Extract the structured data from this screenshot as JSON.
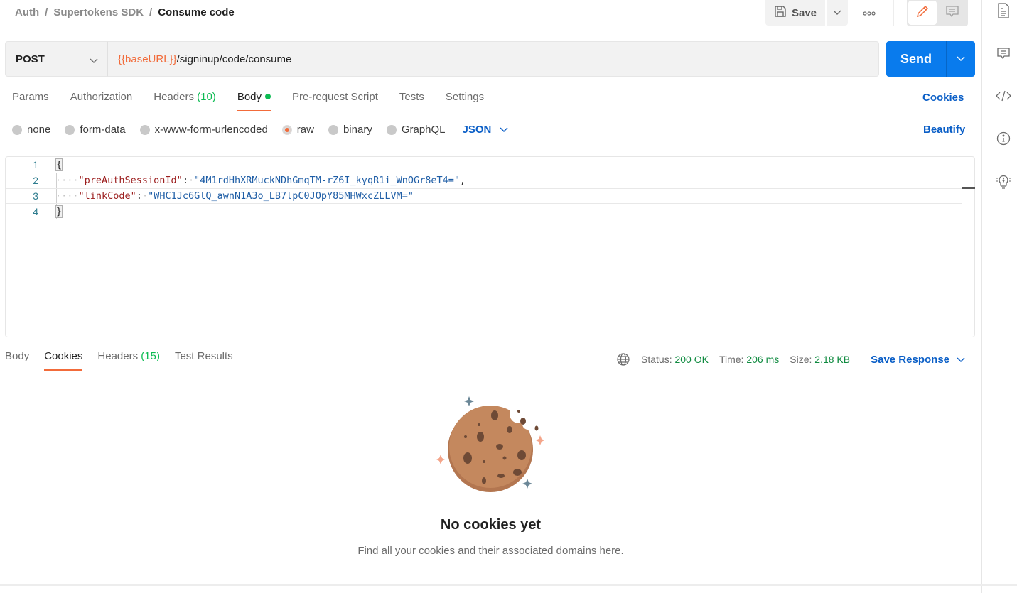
{
  "header": {
    "breadcrumb": [
      "Auth",
      "Supertokens SDK"
    ],
    "current": "Consume code",
    "save_label": "Save"
  },
  "request": {
    "method": "POST",
    "url_variable": "{{baseURL}}",
    "url_path": "/signinup/code/consume",
    "send_label": "Send"
  },
  "request_tabs": {
    "params": "Params",
    "authorization": "Authorization",
    "headers": "Headers",
    "headers_count": "(10)",
    "body": "Body",
    "pre_request": "Pre-request Script",
    "tests": "Tests",
    "settings": "Settings",
    "cookies_link": "Cookies"
  },
  "body_types": {
    "options": [
      "none",
      "form-data",
      "x-www-form-urlencoded",
      "raw",
      "binary",
      "GraphQL"
    ],
    "selected": "raw",
    "format": "JSON",
    "beautify": "Beautify"
  },
  "editor": {
    "line_numbers": [
      "1",
      "2",
      "3",
      "4"
    ],
    "open_brace": "{",
    "close_brace": "}",
    "key1": "\"preAuthSessionId\"",
    "val1": "\"4M1rdHhXRMuckNDhGmqTM-rZ6I_kyqR1i_WnOGr8eT4=\"",
    "key2": "\"linkCode\"",
    "val2": "\"WHC1Jc6GlQ_awnN1A3o_LB7lpC0JOpY85MHWxcZLLVM=\""
  },
  "response_tabs": {
    "body": "Body",
    "cookies": "Cookies",
    "headers": "Headers",
    "headers_count": "(15)",
    "test_results": "Test Results"
  },
  "response_meta": {
    "status_label": "Status:",
    "status_value": "200 OK",
    "time_label": "Time:",
    "time_value": "206 ms",
    "size_label": "Size:",
    "size_value": "2.18 KB",
    "save_response": "Save Response"
  },
  "empty_state": {
    "title": "No cookies yet",
    "description": "Find all your cookies and their associated domains here."
  },
  "colors": {
    "accent": "#f26b3a",
    "primary": "#097bed",
    "link": "#0b5fc7",
    "success": "#0cbb52"
  }
}
